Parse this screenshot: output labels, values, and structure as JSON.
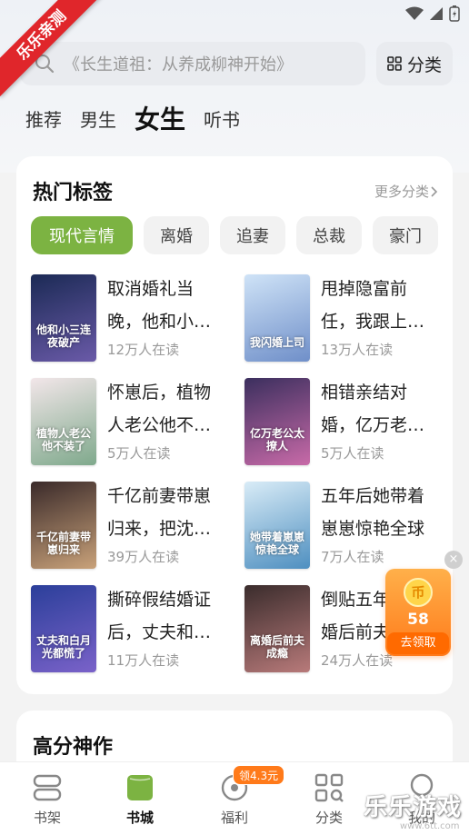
{
  "ribbon": "乐乐亲测",
  "search": {
    "placeholder": "《长生道祖：从养成柳神开始》"
  },
  "category_button": {
    "label": "分类"
  },
  "tabs": [
    {
      "label": "推荐",
      "active": false
    },
    {
      "label": "男生",
      "active": false
    },
    {
      "label": "女生",
      "active": true
    },
    {
      "label": "听书",
      "active": false
    }
  ],
  "hot_tags": {
    "title": "热门标签",
    "more": "更多分类",
    "tags": [
      "现代言情",
      "离婚",
      "追妻",
      "总裁",
      "豪门"
    ],
    "books": [
      {
        "title": "取消婚礼当晚，他和小…",
        "readers": "12万人在读",
        "cover_text": "他和小三连夜破产",
        "color_a": "#1b2a55",
        "color_b": "#6a5aa8"
      },
      {
        "title": "甩掉隐富前任，我跟上…",
        "readers": "13万人在读",
        "cover_text": "我闪婚上司",
        "color_a": "#cfe3f7",
        "color_b": "#6f8fc9"
      },
      {
        "title": "怀崽后，植物人老公他不…",
        "readers": "5万人在读",
        "cover_text": "植物人老公他不装了",
        "color_a": "#f2e6e9",
        "color_b": "#7fa98c"
      },
      {
        "title": "相错亲结对婚，亿万老…",
        "readers": "5万人在读",
        "cover_text": "亿万老公太撩人",
        "color_a": "#3b2f5e",
        "color_b": "#c86aa8"
      },
      {
        "title": "千亿前妻带崽归来，把沈…",
        "readers": "39万人在读",
        "cover_text": "千亿前妻带崽归来",
        "color_a": "#3a2a2a",
        "color_b": "#c9a27a"
      },
      {
        "title": "五年后她带着崽崽惊艳全球",
        "readers": "7万人在读",
        "cover_text": "她带着崽崽惊艳全球",
        "color_a": "#d9ecf7",
        "color_b": "#4e8fc0"
      },
      {
        "title": "撕碎假结婚证后，丈夫和…",
        "readers": "11万人在读",
        "cover_text": "丈夫和白月光都慌了",
        "color_a": "#2b3f9a",
        "color_b": "#7a62c9"
      },
      {
        "title": "倒贴五年，离婚后前夫…",
        "readers": "24万人在读",
        "cover_text": "离婚后前夫成瘾",
        "color_a": "#3a2c2c",
        "color_b": "#b87a7a"
      }
    ]
  },
  "section2": {
    "title": "高分神作"
  },
  "reward": {
    "amount": "58",
    "coin_glyph": "币",
    "claim": "去领取",
    "close": "×"
  },
  "nav": {
    "badge": "领4.3元",
    "items": [
      {
        "label": "书架",
        "active": false,
        "icon": "bookshelf-icon"
      },
      {
        "label": "书城",
        "active": true,
        "icon": "bookstore-icon"
      },
      {
        "label": "福利",
        "active": false,
        "icon": "welfare-icon"
      },
      {
        "label": "分类",
        "active": false,
        "icon": "category-icon"
      },
      {
        "label": "我的",
        "active": false,
        "icon": "profile-icon"
      }
    ]
  },
  "watermark": {
    "text": "乐乐游戏",
    "url": "www.6tt.com"
  },
  "colors": {
    "accent": "#7cb342",
    "reward": "#ff7a1a",
    "ribbon": "#e0262b"
  }
}
